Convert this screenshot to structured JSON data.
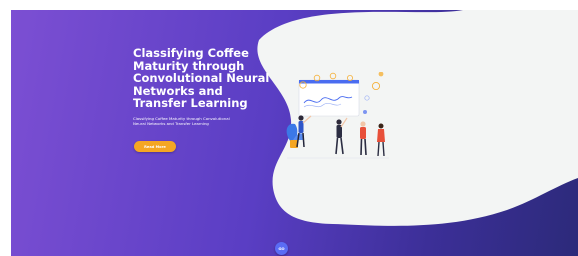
{
  "hero": {
    "title": "Classifying Coffee Maturity through Convolutional Neural Networks and Transfer Learning",
    "subtitle": "Classifying Coffee Maturity through Convolutional Neural Networks and Transfer Learning",
    "cta_label": "Read More",
    "scroll_label": "GO",
    "illustration_icon": "team-analytics-illustration"
  },
  "colors": {
    "gradient_start": "#7c4fd3",
    "gradient_end": "#2c2a7a",
    "blob": "#f3f5f4",
    "cta": "#f5a623",
    "scroll_button": "#5a6cf5"
  }
}
